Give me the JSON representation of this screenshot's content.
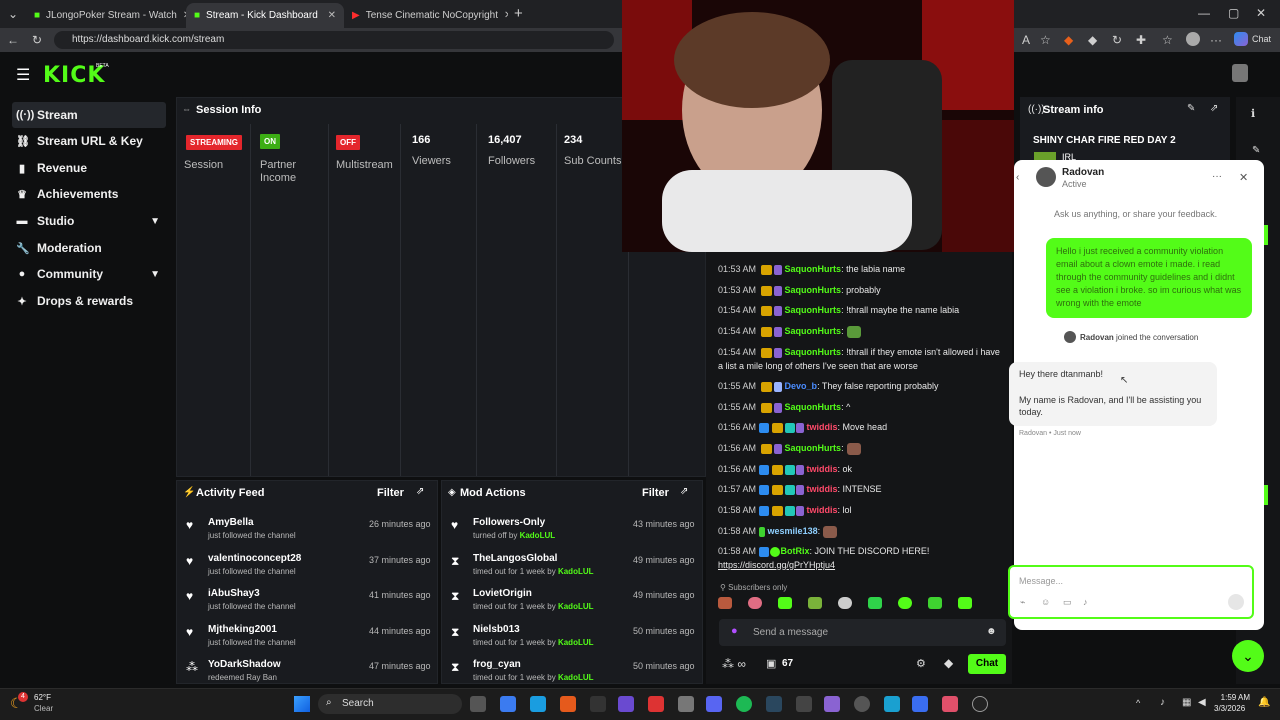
{
  "browser": {
    "tabs": [
      {
        "label": "JLongoPoker Stream - Watch"
      },
      {
        "label": "Stream - Kick Dashboard"
      },
      {
        "label": "Tense Cinematic NoCopyright"
      }
    ],
    "url": "https://dashboard.kick.com/stream",
    "new_tab": "+"
  },
  "header": {
    "logo": "KICK",
    "beta": "BETA"
  },
  "sidebar": {
    "items": [
      {
        "label": "Stream",
        "icon": "broadcast-icon"
      },
      {
        "label": "Stream URL & Key",
        "icon": "link-icon"
      },
      {
        "label": "Revenue",
        "icon": "chart-icon"
      },
      {
        "label": "Achievements",
        "icon": "trophy-icon"
      },
      {
        "label": "Studio",
        "icon": "studio-icon"
      },
      {
        "label": "Moderation",
        "icon": "wrench-icon"
      },
      {
        "label": "Community",
        "icon": "people-icon"
      },
      {
        "label": "Drops & rewards",
        "icon": "gift-icon"
      }
    ]
  },
  "session": {
    "title": "Session Info",
    "stats": [
      {
        "badge": "STREAMING",
        "label": "Session",
        "color": "#e4262c"
      },
      {
        "badge": "ON",
        "label": "Partner Income",
        "color": "#3cae14"
      },
      {
        "badge": "OFF",
        "label": "Multistream",
        "color": "#e4262c"
      },
      {
        "value": "166",
        "label": "Viewers"
      },
      {
        "value": "16,407",
        "label": "Followers"
      },
      {
        "value": "234",
        "label": "Sub Counts"
      }
    ]
  },
  "activity": {
    "title": "Activity Feed",
    "filter": "Filter",
    "rows": [
      {
        "name": "AmyBella",
        "sub": "just followed the channel",
        "time": "26 minutes ago"
      },
      {
        "name": "valentinoconcept28",
        "sub": "just followed the channel",
        "time": "37 minutes ago"
      },
      {
        "name": "iAbuShay3",
        "sub": "just followed the channel",
        "time": "41 minutes ago"
      },
      {
        "name": "Mjtheking2001",
        "sub": "just followed the channel",
        "time": "44 minutes ago"
      },
      {
        "name": "YoDarkShadow",
        "sub": "redeemed Ray Ban",
        "time": "47 minutes ago"
      }
    ]
  },
  "mod": {
    "title": "Mod Actions",
    "filter": "Filter",
    "rows": [
      {
        "name": "Followers-Only",
        "sub": "turned off by",
        "by": "KadoLUL",
        "time": "43 minutes ago"
      },
      {
        "name": "TheLangosGlobal",
        "sub": "timed out for 1 week by",
        "by": "KadoLUL",
        "time": "49 minutes ago"
      },
      {
        "name": "LovietOrigin",
        "sub": "timed out for 1 week by",
        "by": "KadoLUL",
        "time": "49 minutes ago"
      },
      {
        "name": "Nielsb013",
        "sub": "timed out for 1 week by",
        "by": "KadoLUL",
        "time": "50 minutes ago"
      },
      {
        "name": "frog_cyan",
        "sub": "timed out for 1 week by",
        "by": "KadoLUL",
        "time": "50 minutes ago"
      }
    ]
  },
  "chat": {
    "lines": [
      {
        "time": "01:53 AM",
        "user": "SaquonHurts",
        "msg": ": the labia name"
      },
      {
        "time": "01:53 AM",
        "user": "SaquonHurts",
        "msg": ": probably"
      },
      {
        "time": "01:54 AM",
        "user": "SaquonHurts",
        "msg": ": !thrall maybe the name labia"
      },
      {
        "time": "01:54 AM",
        "user": "SaquonHurts",
        "msg": ":"
      },
      {
        "time": "01:54 AM",
        "user": "SaquonHurts",
        "msg": ": !thrall if they emote isn't allowed i have"
      },
      {
        "time": "",
        "user": "",
        "msg": "a list a mile long of others I've seen that are worse"
      },
      {
        "time": "01:55 AM",
        "user": "Devo_b",
        "msg": ": They false reporting probably"
      },
      {
        "time": "01:55 AM",
        "user": "SaquonHurts",
        "msg": ": ^"
      },
      {
        "time": "01:56 AM",
        "user": "twiddis",
        "msg": ": Move head"
      },
      {
        "time": "01:56 AM",
        "user": "SaquonHurts",
        "msg": ":"
      },
      {
        "time": "01:56 AM",
        "user": "twiddis",
        "msg": ": ok"
      },
      {
        "time": "01:57 AM",
        "user": "twiddis",
        "msg": ": INTENSE"
      },
      {
        "time": "01:58 AM",
        "user": "twiddis",
        "msg": ": lol"
      },
      {
        "time": "01:58 AM",
        "user": "wesmile138",
        "msg": ":"
      },
      {
        "time": "01:58 AM",
        "user": "BotRix",
        "msg": ": JOIN THE DISCORD HERE!"
      },
      {
        "time": "",
        "user": "",
        "msg": "https://discord.gg/gPrYHptju4"
      }
    ],
    "subscribers_only": "Subscribers only",
    "placeholder": "Send a message",
    "viewers": "67",
    "chat_button": "Chat"
  },
  "stream_info": {
    "title": "Stream info",
    "stream_title": "SHINY CHAR FIRE RED DAY 2",
    "category": "IRL"
  },
  "support": {
    "agent": "Radovan",
    "status": "Active",
    "prompt": "Ask us anything, or share your feedback.",
    "user_message": "Hello i just received a community violation email about a clown emote i made. i read through the community guidelines and i didnt see a violation i broke. so im curious what was wrong with the emote",
    "joined": "joined the conversation",
    "reply1": "Hey there dtanmanb!",
    "reply2": "My name is Radovan, and I'll be assisting you today.",
    "reply_meta": "Radovan • Just now",
    "placeholder": "Message..."
  },
  "taskbar": {
    "weather_temp": "62°F",
    "weather_cond": "Clear",
    "search": "Search",
    "time": "1:59 AM",
    "date": "3/3/2026",
    "badge": "4"
  },
  "colors": {
    "kick_green": "#53fc18",
    "live_red": "#e4262c"
  }
}
